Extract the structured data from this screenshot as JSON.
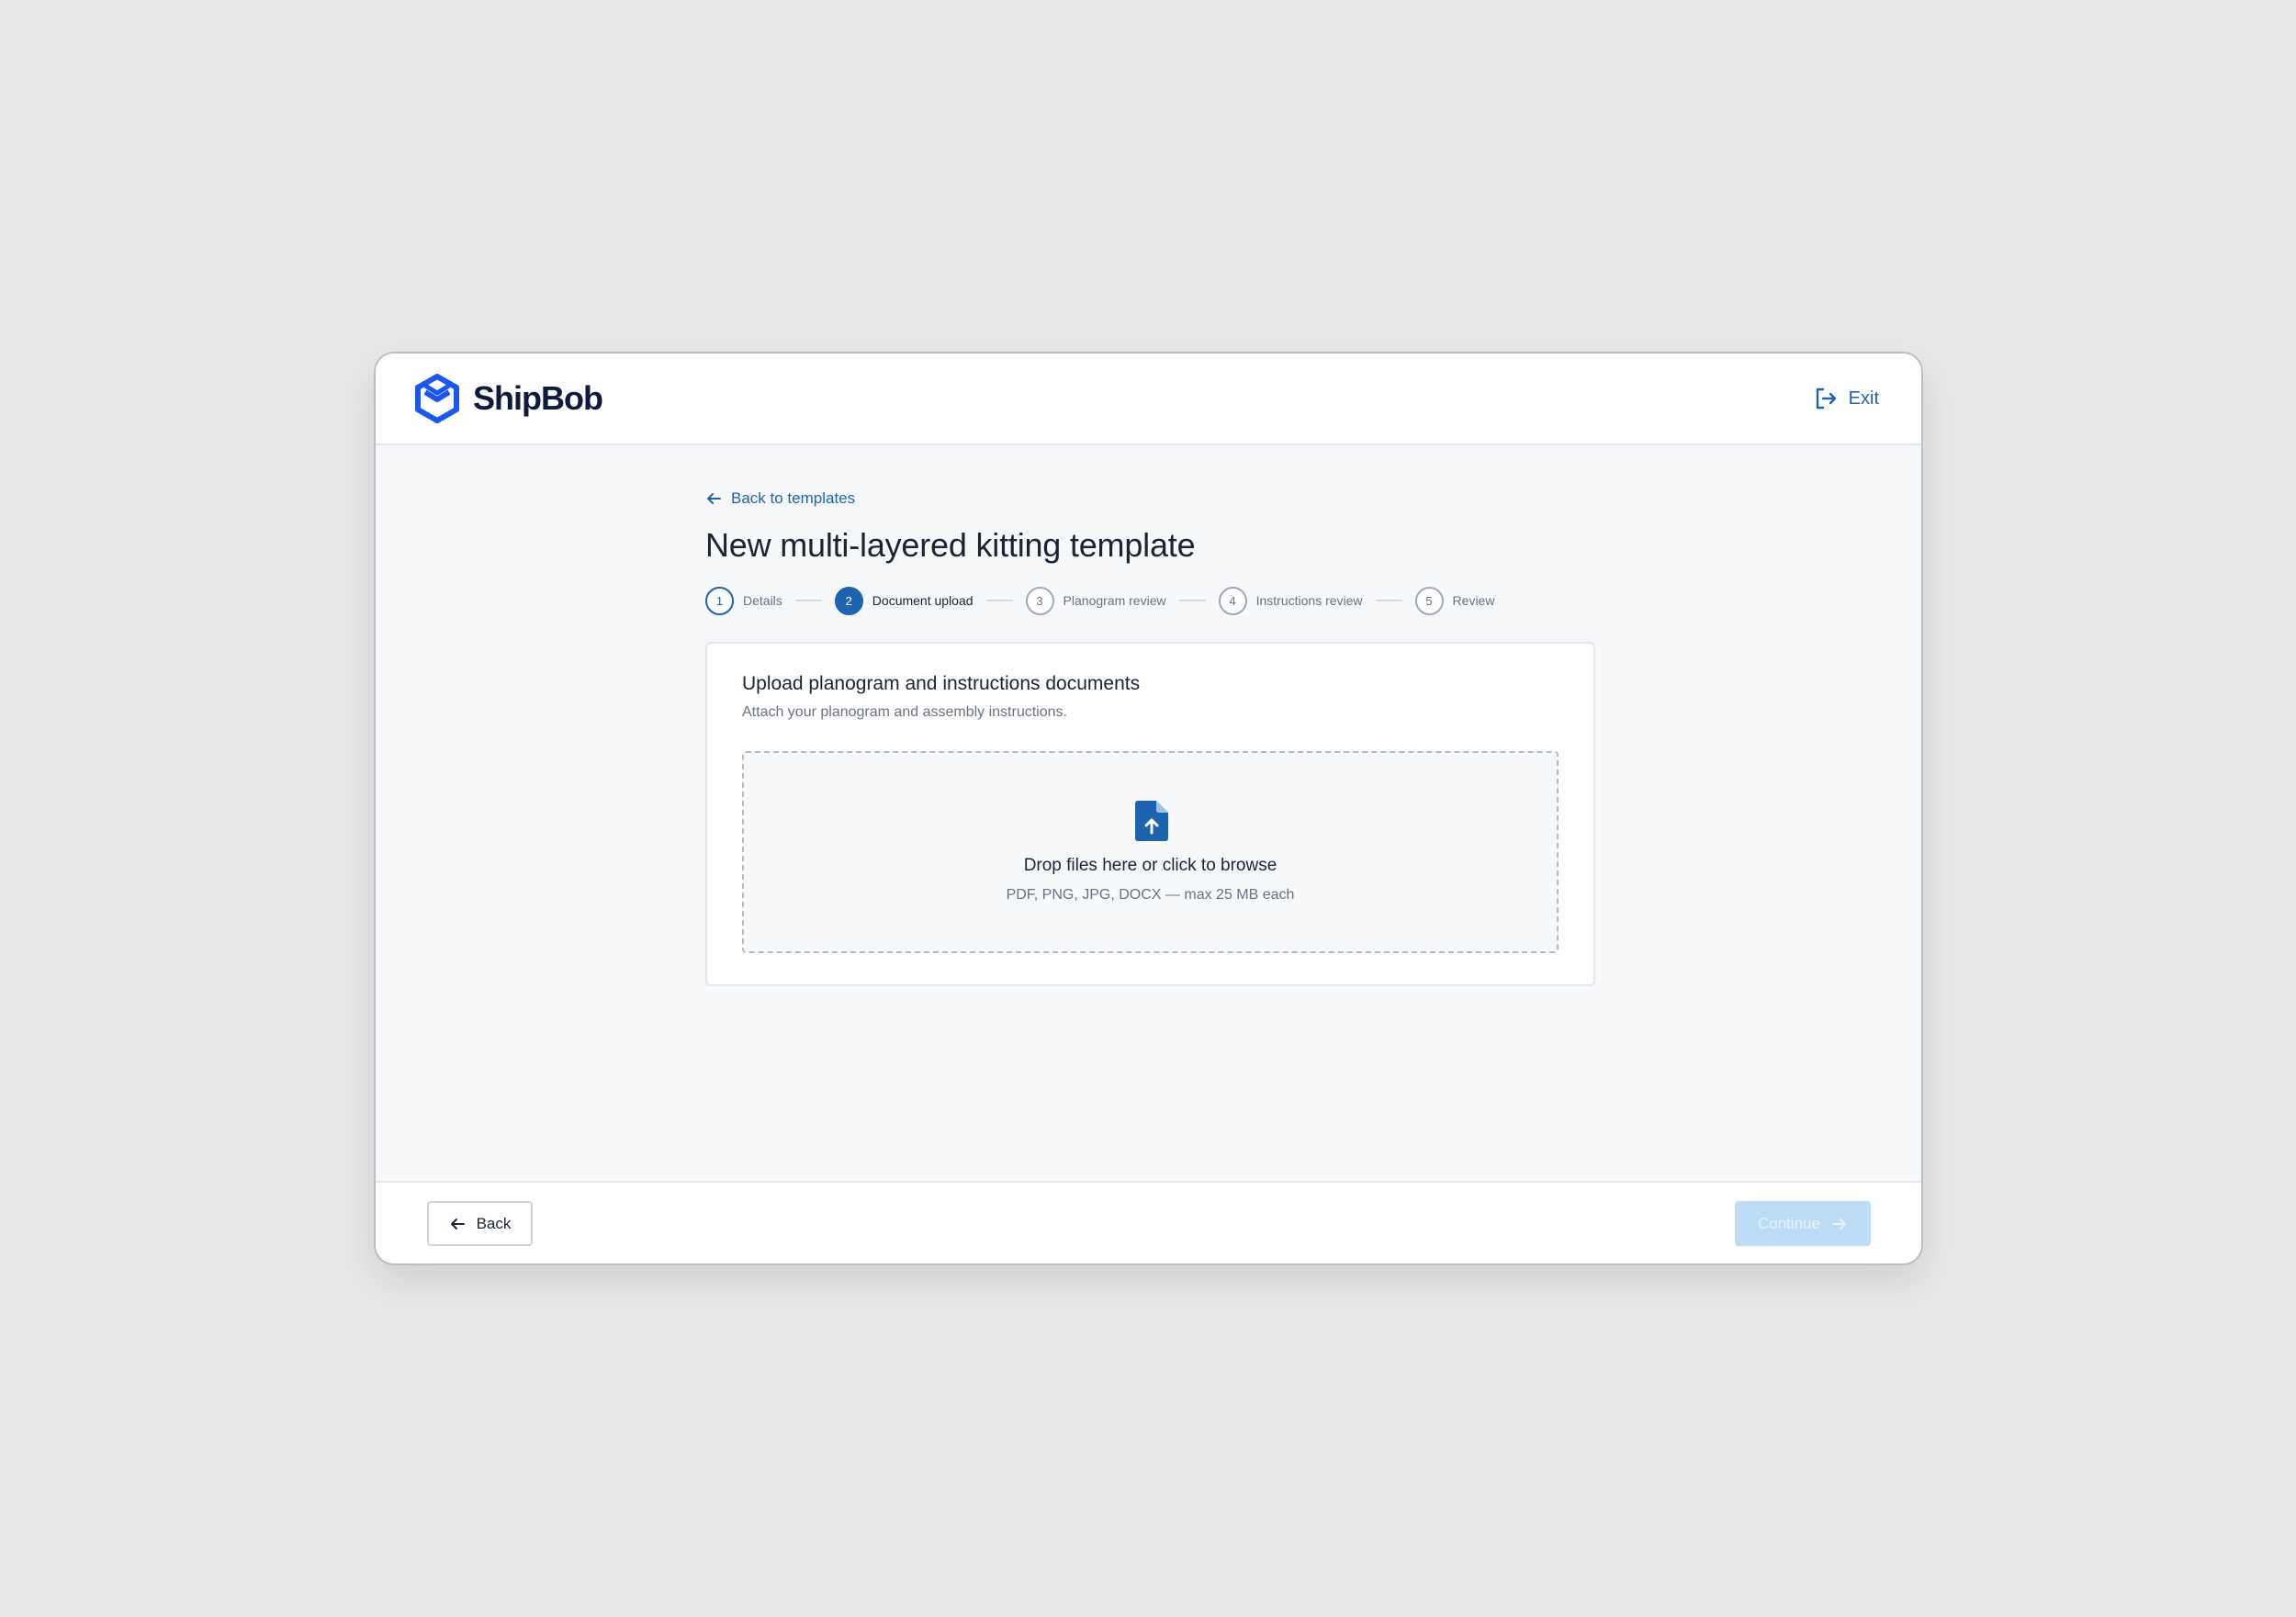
{
  "header": {
    "brand": "ShipBob",
    "exit_label": "Exit"
  },
  "nav": {
    "back_link": "Back to templates"
  },
  "page": {
    "title": "New multi-layered kitting template"
  },
  "stepper": {
    "current_step": 2,
    "steps": [
      {
        "number": "1",
        "label": "Details",
        "state": "done"
      },
      {
        "number": "2",
        "label": "Document upload",
        "state": "active"
      },
      {
        "number": "3",
        "label": "Planogram review",
        "state": "upcoming"
      },
      {
        "number": "4",
        "label": "Instructions review",
        "state": "upcoming"
      },
      {
        "number": "5",
        "label": "Review",
        "state": "upcoming"
      }
    ]
  },
  "upload_card": {
    "title": "Upload planogram and instructions documents",
    "subtitle": "Attach your planogram and assembly instructions.",
    "dropzone": {
      "icon": "file-upload-icon",
      "title": "Drop files here or click to browse",
      "hint": "PDF, PNG, JPG, DOCX — max 25 MB each"
    }
  },
  "footer": {
    "back_label": "Back",
    "continue_label": "Continue",
    "continue_disabled": true
  },
  "colors": {
    "primary": "#1e63b0",
    "brand_logo": "#1a56f0",
    "continue_disabled_bg": "#bfdcf6",
    "page_bg": "#e8e8e8"
  }
}
